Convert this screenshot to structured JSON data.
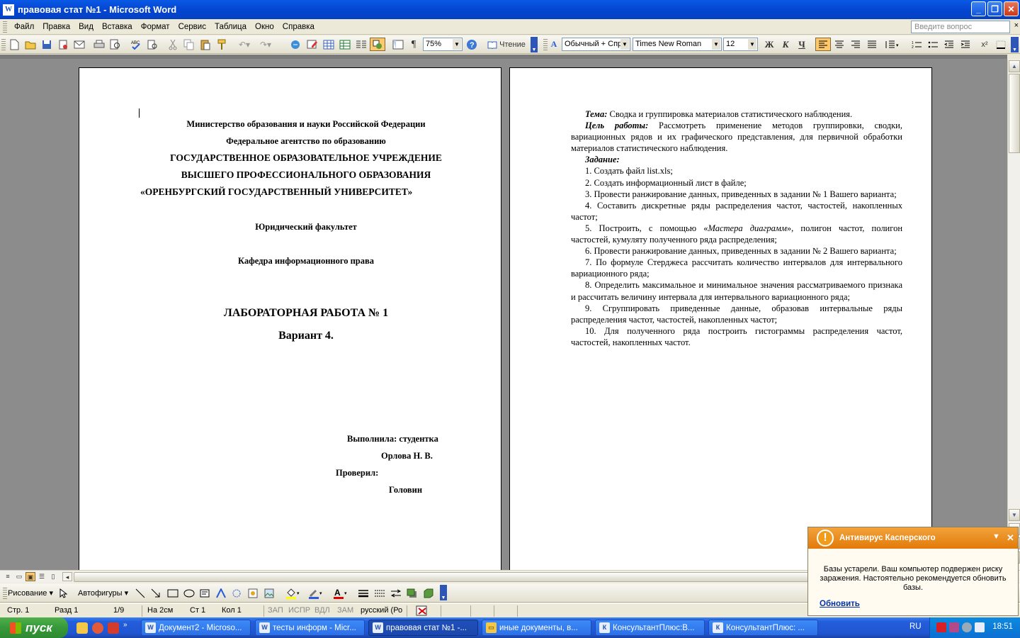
{
  "window": {
    "title": "правовая стат №1 - Microsoft Word",
    "app_icon_letter": "W",
    "minimize": "_",
    "restore": "❐",
    "close": "✕"
  },
  "menu": {
    "items": [
      "Файл",
      "Правка",
      "Вид",
      "Вставка",
      "Формат",
      "Сервис",
      "Таблица",
      "Окно",
      "Справка"
    ],
    "help_placeholder": "Введите вопрос",
    "close": "×"
  },
  "toolbar": {
    "zoom": "75%",
    "reading_label": "Чтение",
    "style": "Обычный + Спр",
    "font": "Times New Roman",
    "size": "12",
    "bold": "Ж",
    "italic": "К",
    "underline": "Ч",
    "paragraph_mark": "¶",
    "superscript": "x²",
    "help_icon": "?"
  },
  "title_page": {
    "lines": [
      "Министерство образования и науки Российской Федерации",
      "Федеральное агентство по образованию",
      "ГОСУДАРСТВЕННОЕ ОБРАЗОВАТЕЛЬНОЕ УЧРЕЖДЕНИЕ",
      "ВЫСШЕГО ПРОФЕССИОНАЛЬНОГО ОБРАЗОВАНИЯ",
      "«ОРЕНБУРГСКИЙ ГОСУДАРСТВЕННЫЙ УНИВЕРСИТЕТ»"
    ],
    "faculty": "Юридический факультет",
    "department": "Кафедра информационного права",
    "work_title": "ЛАБОРАТОРНАЯ РАБОТА № 1",
    "variant": "Вариант 4.",
    "performed_by": "Выполнила: студентка",
    "student": "Орлова Н. В.",
    "checked_by": "Проверил:",
    "teacher": "Головин"
  },
  "task_page": {
    "topic_label": "Тема:",
    "topic": " Сводка и группировка материалов статистического наблюдения.",
    "goal_label": "Цель работы:",
    "goal": " Рассмотреть применение методов группировки, сводки, вариационных рядов и их графического представления, для первичной обработки материалов статистического наблюдения.",
    "assignment_label": "Задание:",
    "items": [
      "1. Создать файл list.xls;",
      "2. Создать информационный лист в файле;",
      "3. Провести ранжирование данных, приведенных в задании № 1 Вашего варианта;",
      "4. Составить дискретные ряды распределения частот, частостей, накопленных частот;",
      "",
      "6. Провести ранжирование данных, приведенных в задании № 2 Вашего варианта;",
      "7. По формуле Стерджеса рассчитать количество интервалов для интервального вариационного ряда;",
      "8. Определить максимальное и минимальное значения рассматриваемого признака и рассчитать величину интервала для интервального вариационного ряда;",
      "9. Сгруппировать приведенные данные, образовав интервальные ряды распределения частот, частостей, накопленных частот;",
      "10. Для полученного ряда построить гистограммы распределения частот, частостей, накопленных частот."
    ],
    "item5_pre": "5. Построить, с помощью «",
    "item5_italic": "Мастера диаграмм",
    "item5_post": "», полигон частот, полигон частостей, кумуляту полученного ряда распределения;"
  },
  "drawing": {
    "draw_label": "Рисование",
    "autoshapes_label": "Автофигуры"
  },
  "status": {
    "page": "Стр.  1",
    "section": "Разд  1",
    "pages": "1/9",
    "at": "На  2см",
    "line": "Ст  1",
    "col": "Кол  1",
    "rec": "ЗАП",
    "trk": "ИСПР",
    "ext": "ВДЛ",
    "ovr": "ЗАМ",
    "lang": "русский (Ро"
  },
  "kaspersky": {
    "title": "Антивирус Касперского",
    "icon": "!",
    "message": "Базы устарели. Ваш компьютер подвержен риску заражения. Настоятельно рекомендуется обновить базы.",
    "action": "Обновить",
    "menu_glyph": "▼",
    "close_glyph": "✕"
  },
  "taskbar": {
    "start": "пуск",
    "tasks": [
      "Документ2 - Microso...",
      "тесты информ - Micr...",
      "правовая стат №1 -...",
      "иные документы, в...",
      "КонсультантПлюс:В...",
      "КонсультантПлюс: ..."
    ],
    "lang": "RU",
    "clock": "18:51"
  },
  "colors": {
    "title_blue": "#0547d4",
    "start_green": "#37983a",
    "kaspersky_orange": "#e27a0a",
    "link_blue": "#0033aa"
  }
}
